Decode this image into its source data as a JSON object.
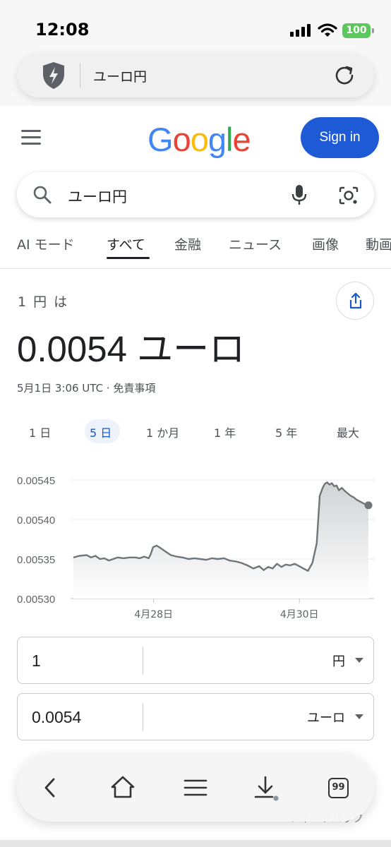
{
  "status_bar": {
    "time": "12:08",
    "battery": "100"
  },
  "browser": {
    "url_text": "ユーロ円"
  },
  "header": {
    "logo": "Google",
    "signin_label": "Sign in"
  },
  "search": {
    "query": "ユーロ円"
  },
  "tabs": [
    {
      "label": "AI モード"
    },
    {
      "label": "すべて",
      "active": true
    },
    {
      "label": "金融"
    },
    {
      "label": "ニュース"
    },
    {
      "label": "画像"
    },
    {
      "label": "動画"
    }
  ],
  "result": {
    "from_text": "1 円 は",
    "amount": "0.0054 ユーロ",
    "timestamp": "5月1日 3:06 UTC · 免責事項"
  },
  "ranges": [
    {
      "label": "1 日"
    },
    {
      "label": "5 日",
      "active": true
    },
    {
      "label": "1 か月"
    },
    {
      "label": "1 年"
    },
    {
      "label": "5 年"
    },
    {
      "label": "最大"
    }
  ],
  "chart_data": {
    "type": "area",
    "ylim": [
      0.0053,
      0.00545
    ],
    "yticks": [
      "0.00545",
      "0.00540",
      "0.00535",
      "0.00530"
    ],
    "xticks": [
      "4月28日",
      "4月30日"
    ],
    "xtick_positions": [
      0.272,
      0.766
    ],
    "x": [
      0,
      0.02,
      0.045,
      0.06,
      0.075,
      0.09,
      0.105,
      0.12,
      0.135,
      0.15,
      0.17,
      0.19,
      0.21,
      0.225,
      0.24,
      0.255,
      0.262,
      0.27,
      0.282,
      0.295,
      0.31,
      0.33,
      0.35,
      0.37,
      0.39,
      0.41,
      0.43,
      0.45,
      0.47,
      0.49,
      0.51,
      0.53,
      0.55,
      0.57,
      0.59,
      0.61,
      0.63,
      0.645,
      0.66,
      0.675,
      0.69,
      0.705,
      0.72,
      0.735,
      0.75,
      0.765,
      0.78,
      0.795,
      0.81,
      0.825,
      0.835,
      0.845,
      0.852,
      0.86,
      0.868,
      0.876,
      0.884,
      0.892,
      0.9,
      0.91,
      0.92,
      0.93,
      0.94,
      0.95,
      0.96,
      0.97,
      0.985,
      1.0
    ],
    "values": [
      0.005352,
      0.005354,
      0.005355,
      0.005352,
      0.005354,
      0.00535,
      0.005351,
      0.005348,
      0.00535,
      0.005352,
      0.005351,
      0.005352,
      0.005352,
      0.005351,
      0.005353,
      0.005351,
      0.005356,
      0.005365,
      0.005367,
      0.005364,
      0.00536,
      0.005355,
      0.005353,
      0.005352,
      0.00535,
      0.005351,
      0.00535,
      0.005349,
      0.005351,
      0.00535,
      0.005351,
      0.005348,
      0.005347,
      0.005345,
      0.005342,
      0.005338,
      0.005341,
      0.005336,
      0.00534,
      0.005338,
      0.005344,
      0.00534,
      0.005343,
      0.005342,
      0.005344,
      0.005341,
      0.005338,
      0.005335,
      0.005345,
      0.00537,
      0.00543,
      0.00544,
      0.005445,
      0.005447,
      0.005444,
      0.005446,
      0.005442,
      0.005443,
      0.005437,
      0.00544,
      0.005436,
      0.005433,
      0.00543,
      0.005428,
      0.005425,
      0.005423,
      0.00542,
      0.005418
    ],
    "colors": {
      "line": "#70757a",
      "fill_top": "#d2d3d5",
      "grid": "#e8eaed"
    }
  },
  "converter": [
    {
      "value": "1",
      "unit": "円"
    },
    {
      "value": "0.0054",
      "unit": "ユーロ"
    }
  ],
  "footer": {
    "ghost_link": "フィードバック"
  },
  "toolbar": {
    "tabs_count": "99"
  },
  "colors": {
    "brand_blue": "#1f5ad6",
    "accent_blue": "#1a57c9"
  }
}
